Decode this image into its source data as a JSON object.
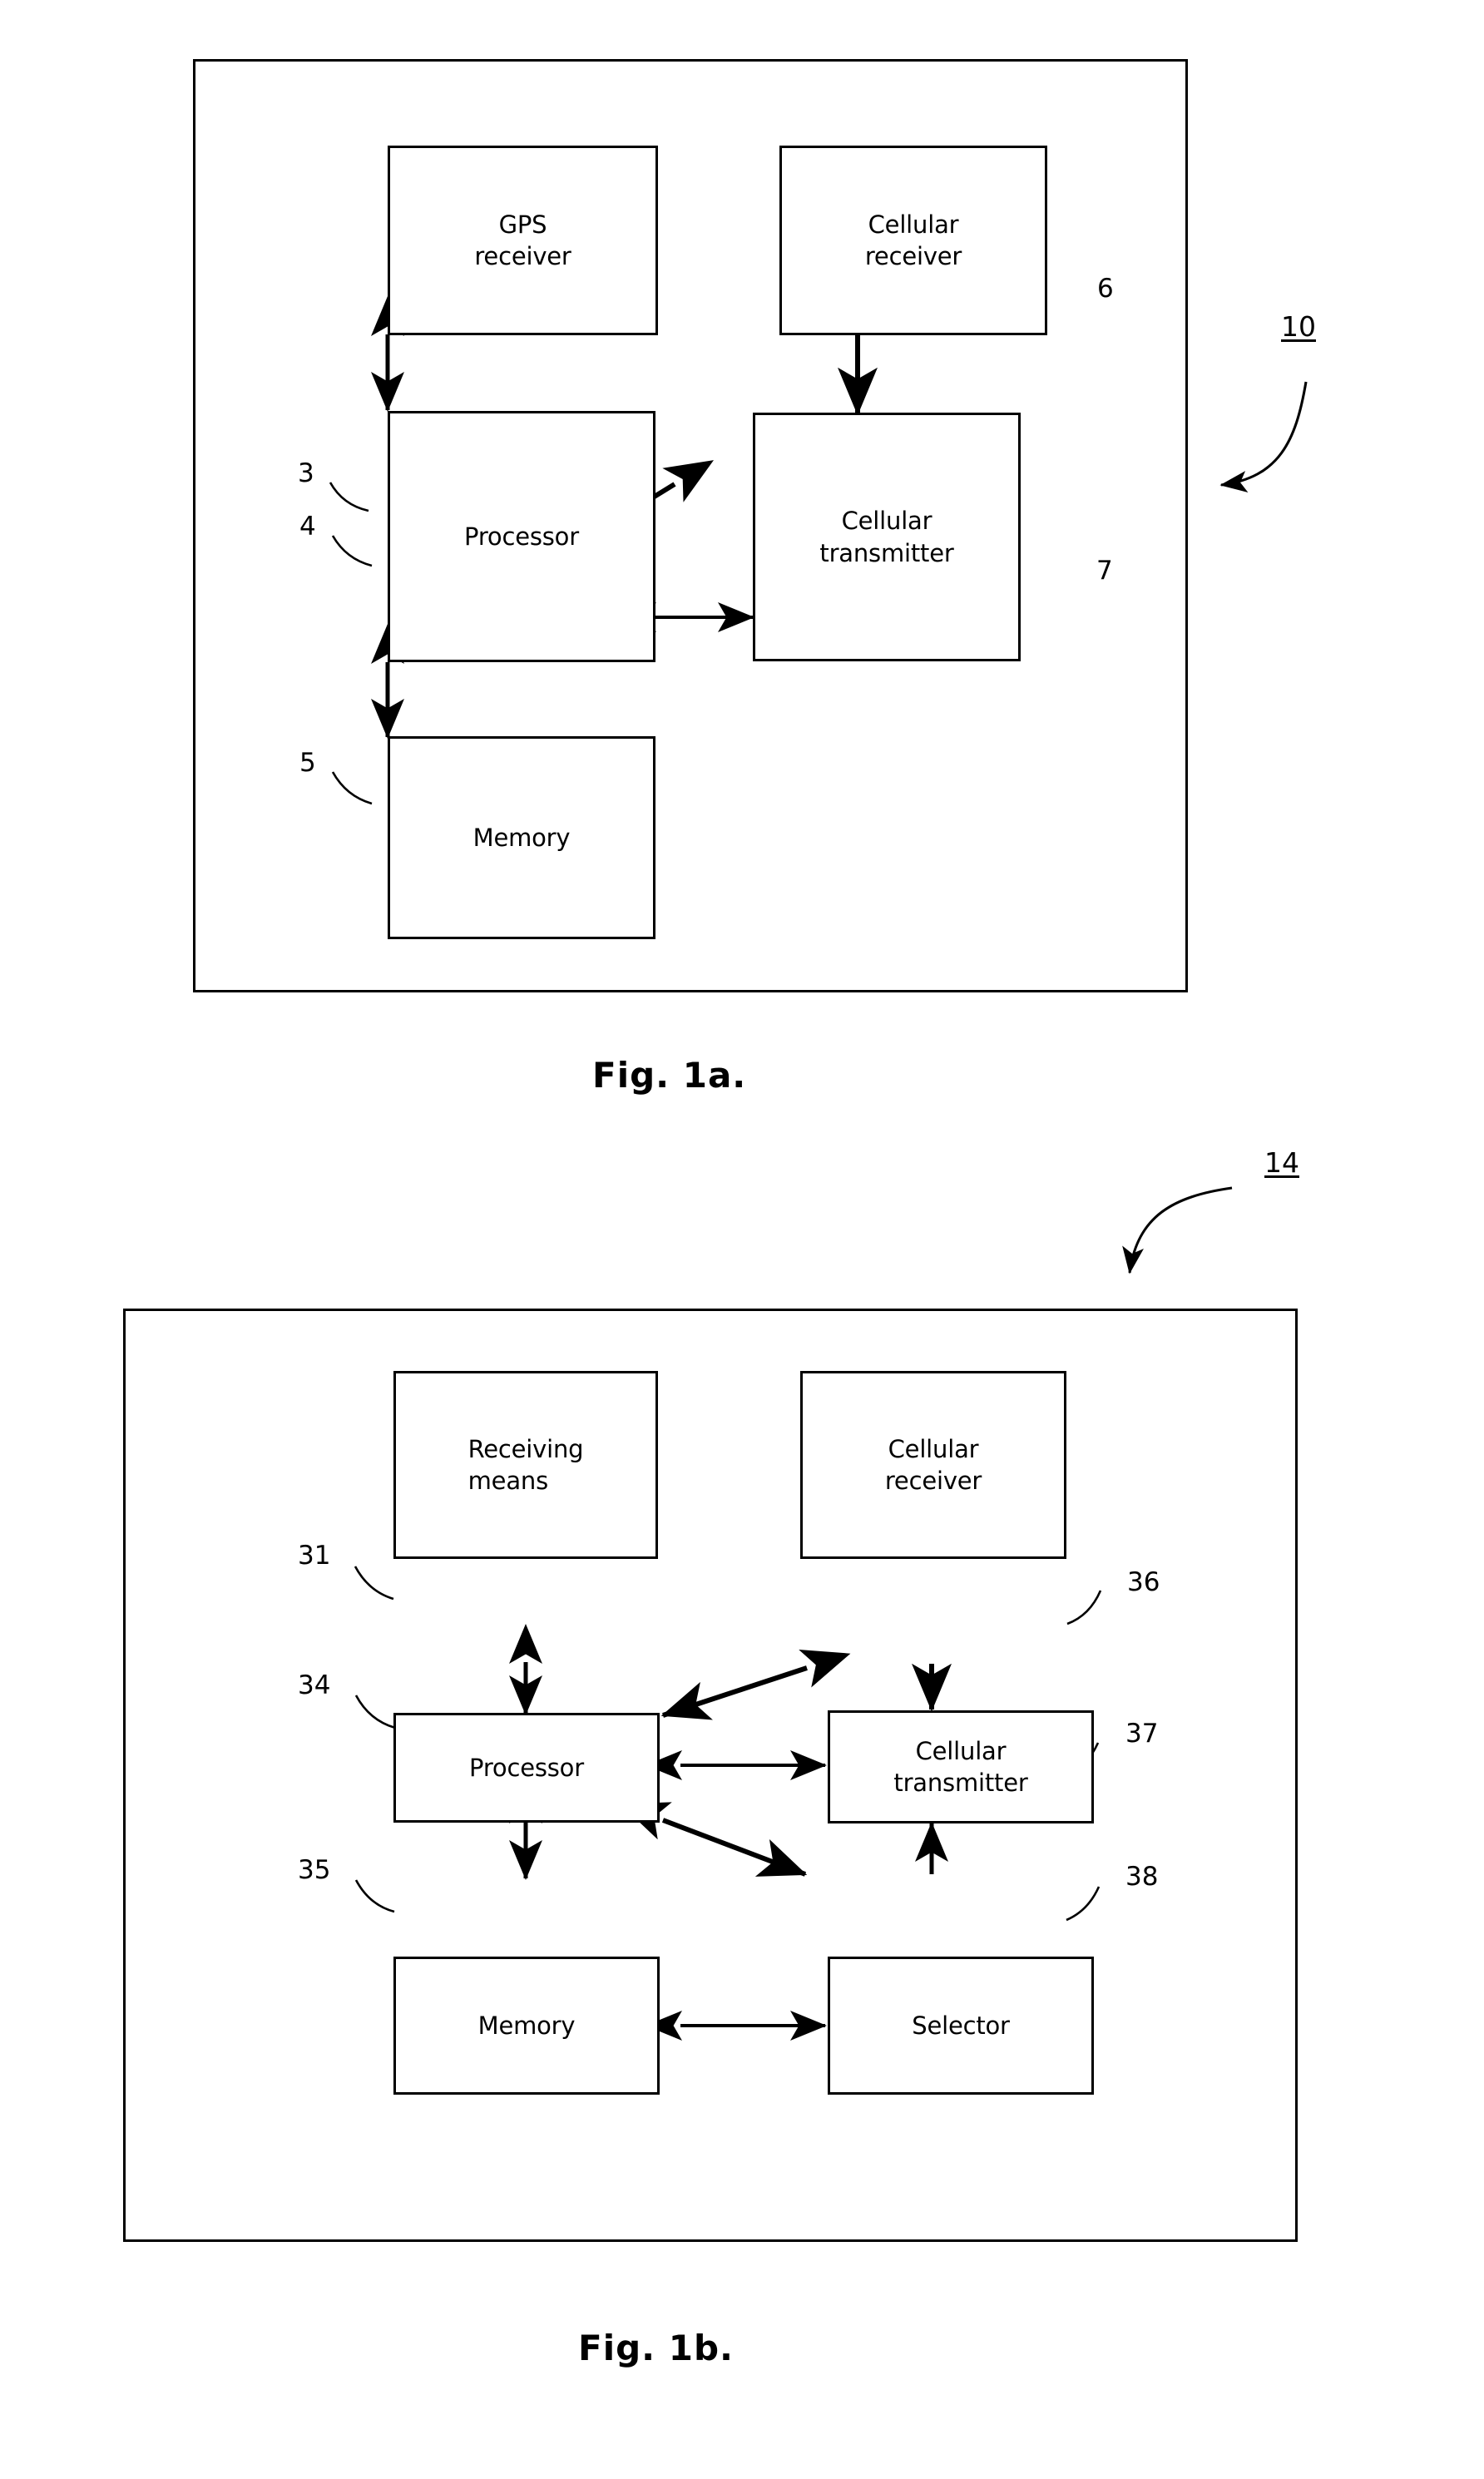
{
  "document": {
    "type": "patent-drawing-sheet",
    "figures": [
      {
        "id": "fig-1a",
        "caption": "Fig. 1a.",
        "device_ref": "10",
        "nodes": [
          {
            "ref": "3",
            "label": "GPS\nreceiver",
            "line1": "GPS",
            "line2": "receiver"
          },
          {
            "ref": "6",
            "label": "Cellular\nreceiver",
            "line1": "Cellular",
            "line2": "receiver"
          },
          {
            "ref": "4",
            "label": "Processor",
            "line1": "Processor",
            "line2": ""
          },
          {
            "ref": "7",
            "label": "Cellular\ntransmitter",
            "line1": "Cellular",
            "line2": "transmitter"
          },
          {
            "ref": "5",
            "label": "Memory",
            "line1": "Memory",
            "line2": ""
          }
        ],
        "connections": [
          {
            "from": "3",
            "to": "4",
            "type": "bidirectional-vertical"
          },
          {
            "from": "4",
            "to": "6",
            "type": "bidirectional-diagonal"
          },
          {
            "from": "6",
            "to": "7",
            "type": "unidirectional-down"
          },
          {
            "from": "4",
            "to": "7",
            "type": "bidirectional-horizontal"
          },
          {
            "from": "4",
            "to": "5",
            "type": "bidirectional-vertical"
          }
        ]
      },
      {
        "id": "fig-1b",
        "caption": "Fig. 1b.",
        "device_ref": "14",
        "nodes": [
          {
            "ref": "31",
            "label": "Receiving\nmeans",
            "line1": "Receiving",
            "line2": "means"
          },
          {
            "ref": "36",
            "label": "Cellular\nreceiver",
            "line1": "Cellular",
            "line2": "receiver"
          },
          {
            "ref": "34",
            "label": "Processor",
            "line1": "Processor",
            "line2": ""
          },
          {
            "ref": "37",
            "label": "Cellular\ntransmitter",
            "line1": "Cellular",
            "line2": "transmitter"
          },
          {
            "ref": "35",
            "label": "Memory",
            "line1": "Memory",
            "line2": ""
          },
          {
            "ref": "38",
            "label": "Selector",
            "line1": "Selector",
            "line2": ""
          }
        ],
        "connections": [
          {
            "from": "31",
            "to": "34",
            "type": "bidirectional-vertical"
          },
          {
            "from": "34",
            "to": "36",
            "type": "bidirectional-diagonal"
          },
          {
            "from": "36",
            "to": "37",
            "type": "unidirectional-down"
          },
          {
            "from": "34",
            "to": "37",
            "type": "bidirectional-horizontal"
          },
          {
            "from": "34",
            "to": "35",
            "type": "bidirectional-vertical"
          },
          {
            "from": "34",
            "to": "38",
            "type": "bidirectional-diagonal"
          },
          {
            "from": "35",
            "to": "38",
            "type": "bidirectional-horizontal"
          },
          {
            "from": "38",
            "to": "37",
            "type": "unidirectional-up"
          }
        ]
      }
    ]
  },
  "colors": {
    "ink": "#000000",
    "paper": "#ffffff"
  }
}
